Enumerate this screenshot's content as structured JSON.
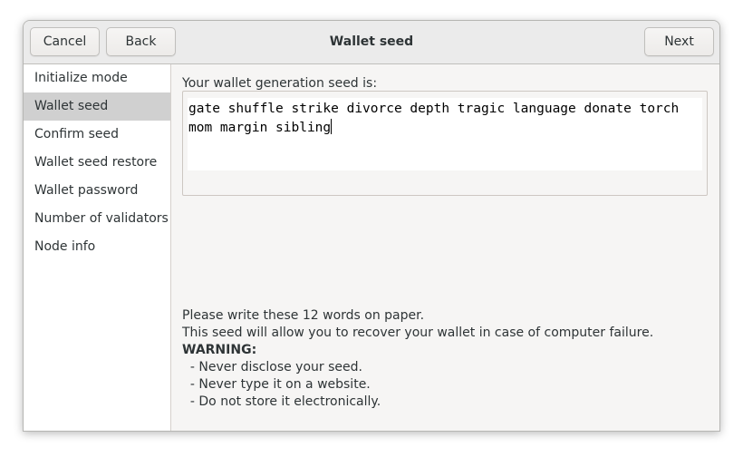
{
  "header": {
    "cancel_label": "Cancel",
    "back_label": "Back",
    "title": "Wallet seed",
    "next_label": "Next"
  },
  "sidebar": {
    "items": [
      {
        "label": "Initialize mode"
      },
      {
        "label": "Wallet seed"
      },
      {
        "label": "Confirm seed"
      },
      {
        "label": "Wallet seed restore"
      },
      {
        "label": "Wallet password"
      },
      {
        "label": "Number of validators"
      },
      {
        "label": "Node info"
      }
    ],
    "active": "Wallet seed"
  },
  "main": {
    "seed_label": "Your wallet generation seed is:",
    "seed_text": "gate shuffle strike divorce depth tragic language donate torch mom margin sibling",
    "info_line1": "Please write these 12 words on paper.",
    "info_line2": "This seed will allow you to recover your wallet in case of computer failure.",
    "warning_label": "WARNING:",
    "warnings": [
      "  - Never disclose your seed.",
      "  - Never type it on a website.",
      "  - Do not store it electronically."
    ]
  }
}
